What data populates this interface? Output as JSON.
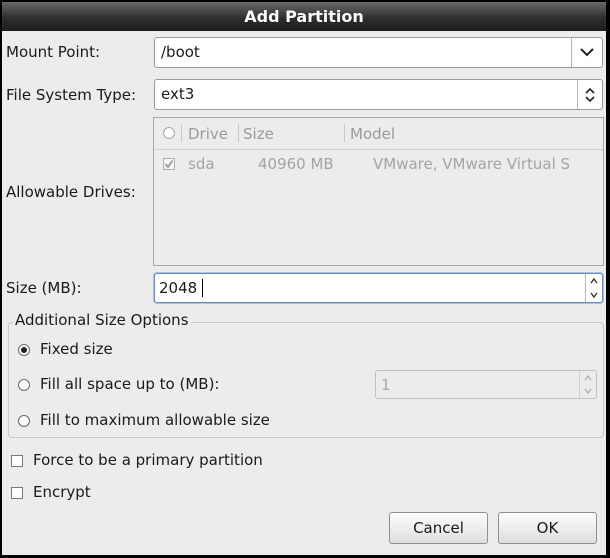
{
  "dialog": {
    "title": "Add Partition"
  },
  "mount_point": {
    "label": "Mount Point:",
    "value": "/boot"
  },
  "fs_type": {
    "label": "File System Type:",
    "value": "ext3"
  },
  "drives": {
    "label": "Allowable Drives:",
    "columns": [
      "Drive",
      "Size",
      "Model"
    ],
    "rows": [
      {
        "checked": true,
        "drive": "sda",
        "size": "40960 MB",
        "model": "VMware, VMware Virtual S"
      }
    ]
  },
  "size": {
    "label": "Size (MB):",
    "value": "2048"
  },
  "additional": {
    "legend": "Additional Size Options",
    "fixed": "Fixed size",
    "fill_upto": "Fill all space up to (MB):",
    "fill_upto_value": "1",
    "fill_max": "Fill to maximum allowable size",
    "selected": "fixed"
  },
  "options": {
    "primary": "Force to be a primary partition",
    "encrypt": "Encrypt"
  },
  "buttons": {
    "cancel": "Cancel",
    "ok": "OK"
  }
}
